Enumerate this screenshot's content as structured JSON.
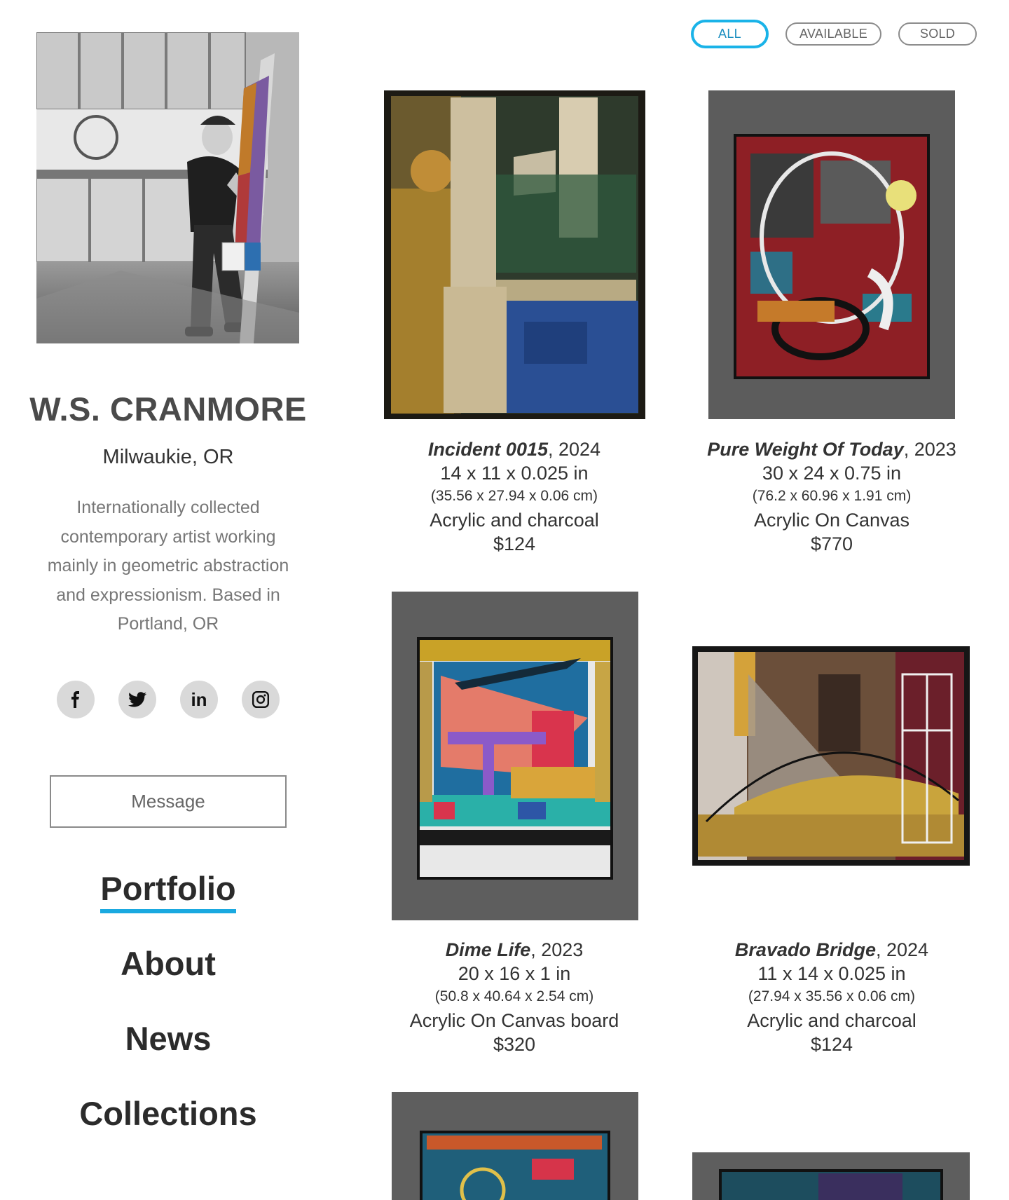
{
  "artist": {
    "name": "W.S. CRANMORE",
    "location": "Milwaukie, OR",
    "bio": "Internationally collected contemporary artist working mainly in geometric abstraction and expressionism. Based in Portland, OR"
  },
  "socials": [
    {
      "name": "facebook-icon",
      "glyph": "f"
    },
    {
      "name": "twitter-icon",
      "glyph": "twitter"
    },
    {
      "name": "linkedin-icon",
      "glyph": "in"
    },
    {
      "name": "instagram-icon",
      "glyph": "instagram"
    }
  ],
  "message_button": "Message",
  "nav": {
    "portfolio": "Portfolio",
    "about": "About",
    "news": "News",
    "collections": "Collections",
    "active": "portfolio"
  },
  "filters": {
    "all": "ALL",
    "available": "AVAILABLE",
    "sold": "SOLD",
    "active": "all"
  },
  "artworks": [
    {
      "title": "Incident 0015",
      "year": ", 2024",
      "dims_in": "14 x 11 x 0.025 in",
      "dims_cm": "(35.56 x 27.94 x 0.06 cm)",
      "medium": "Acrylic and charcoal",
      "price": "$124"
    },
    {
      "title": "Pure Weight Of Today",
      "year": ", 2023",
      "dims_in": "30 x 24 x 0.75 in",
      "dims_cm": "(76.2 x 60.96 x 1.91 cm)",
      "medium": "Acrylic On Canvas",
      "price": "$770"
    },
    {
      "title": "Dime Life",
      "year": ", 2023",
      "dims_in": "20 x 16 x 1 in",
      "dims_cm": "(50.8 x 40.64 x 2.54 cm)",
      "medium": "Acrylic On Canvas board",
      "price": "$320"
    },
    {
      "title": "Bravado Bridge",
      "year": ", 2024",
      "dims_in": "11 x 14 x 0.025 in",
      "dims_cm": "(27.94 x 35.56 x 0.06 cm)",
      "medium": "Acrylic and charcoal",
      "price": "$124"
    }
  ],
  "colors": {
    "accent": "#1aa9e0",
    "text_dark": "#2b2b2b",
    "text_muted": "#777777"
  }
}
